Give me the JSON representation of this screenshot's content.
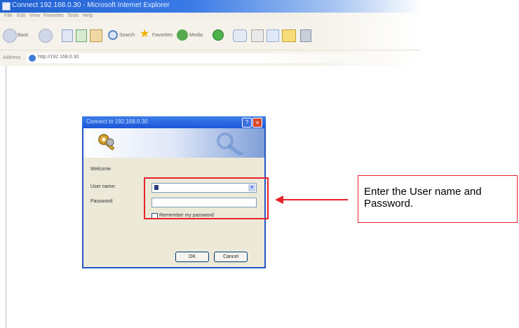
{
  "browser": {
    "title": "Connect 192.168.0.30 - Microsoft Internet Explorer",
    "menu": [
      "File",
      "Edit",
      "View",
      "Favorites",
      "Tools",
      "Help"
    ],
    "toolbar": {
      "back_label": "Back",
      "search_label": "Search",
      "favorites_label": "Favorites",
      "media_label": "Media"
    },
    "address_label": "Address",
    "address_value": "http://192.168.0.30"
  },
  "dialog": {
    "title": "Connect to 192.168.0.30",
    "help_glyph": "?",
    "close_glyph": "×",
    "welcome": "Welcome",
    "username_label": "User name:",
    "password_label": "Password:",
    "username_value": "",
    "password_value": "",
    "remember_label": "Remember my password",
    "remember_checked": false,
    "ok_label": "OK",
    "cancel_label": "Cancel"
  },
  "annotation": {
    "callout_text": "Enter the User name and Password.",
    "color": "#e8222a"
  }
}
